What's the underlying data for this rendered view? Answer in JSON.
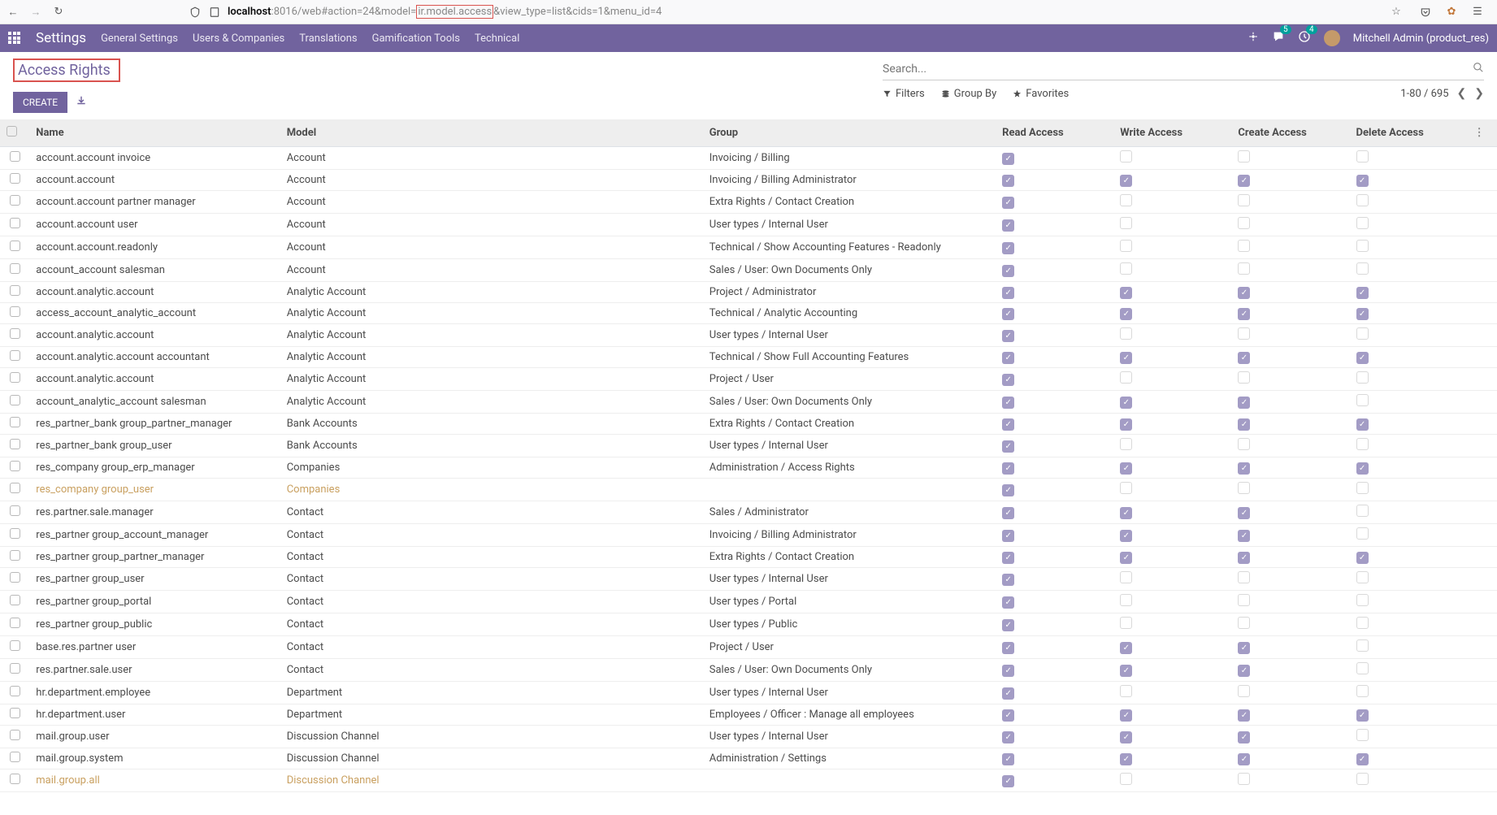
{
  "browser": {
    "url_pre": "localhost",
    "url_port": ":8016/web#action=24&model=",
    "url_highlight": "ir.model.access",
    "url_post": "&view_type=list&cids=1&menu_id=4"
  },
  "top_menu": {
    "title": "Settings",
    "items": [
      "General Settings",
      "Users & Companies",
      "Translations",
      "Gamification Tools",
      "Technical"
    ],
    "msg_badge": "5",
    "activity_badge": "4",
    "user": "Mitchell Admin (product_res)"
  },
  "control_panel": {
    "breadcrumb": "Access Rights",
    "create": "CREATE",
    "search_placeholder": "Search...",
    "filters": "Filters",
    "group_by": "Group By",
    "favorites": "Favorites",
    "pager": "1-80 / 695"
  },
  "table": {
    "headers": {
      "name": "Name",
      "model": "Model",
      "group": "Group",
      "read": "Read Access",
      "write": "Write Access",
      "create": "Create Access",
      "delete": "Delete Access"
    },
    "rows": [
      {
        "name": "account.account invoice",
        "model": "Account",
        "group": "Invoicing / Billing",
        "r": true,
        "w": false,
        "c": false,
        "d": false
      },
      {
        "name": "account.account",
        "model": "Account",
        "group": "Invoicing / Billing Administrator",
        "r": true,
        "w": true,
        "c": true,
        "d": true
      },
      {
        "name": "account.account partner manager",
        "model": "Account",
        "group": "Extra Rights / Contact Creation",
        "r": true,
        "w": false,
        "c": false,
        "d": false
      },
      {
        "name": "account.account user",
        "model": "Account",
        "group": "User types / Internal User",
        "r": true,
        "w": false,
        "c": false,
        "d": false
      },
      {
        "name": "account.account.readonly",
        "model": "Account",
        "group": "Technical / Show Accounting Features - Readonly",
        "r": true,
        "w": false,
        "c": false,
        "d": false
      },
      {
        "name": "account_account salesman",
        "model": "Account",
        "group": "Sales / User: Own Documents Only",
        "r": true,
        "w": false,
        "c": false,
        "d": false
      },
      {
        "name": "account.analytic.account",
        "model": "Analytic Account",
        "group": "Project / Administrator",
        "r": true,
        "w": true,
        "c": true,
        "d": true
      },
      {
        "name": "access_account_analytic_account",
        "model": "Analytic Account",
        "group": "Technical / Analytic Accounting",
        "r": true,
        "w": true,
        "c": true,
        "d": true
      },
      {
        "name": "account.analytic.account",
        "model": "Analytic Account",
        "group": "User types / Internal User",
        "r": true,
        "w": false,
        "c": false,
        "d": false
      },
      {
        "name": "account.analytic.account accountant",
        "model": "Analytic Account",
        "group": "Technical / Show Full Accounting Features",
        "r": true,
        "w": true,
        "c": true,
        "d": true
      },
      {
        "name": "account.analytic.account",
        "model": "Analytic Account",
        "group": "Project / User",
        "r": true,
        "w": false,
        "c": false,
        "d": false
      },
      {
        "name": "account_analytic_account salesman",
        "model": "Analytic Account",
        "group": "Sales / User: Own Documents Only",
        "r": true,
        "w": true,
        "c": true,
        "d": false
      },
      {
        "name": "res_partner_bank group_partner_manager",
        "model": "Bank Accounts",
        "group": "Extra Rights / Contact Creation",
        "r": true,
        "w": true,
        "c": true,
        "d": true
      },
      {
        "name": "res_partner_bank group_user",
        "model": "Bank Accounts",
        "group": "User types / Internal User",
        "r": true,
        "w": false,
        "c": false,
        "d": false
      },
      {
        "name": "res_company group_erp_manager",
        "model": "Companies",
        "group": "Administration / Access Rights",
        "r": true,
        "w": true,
        "c": true,
        "d": true
      },
      {
        "name": "res_company group_user",
        "model": "Companies",
        "group": "",
        "r": true,
        "w": false,
        "c": false,
        "d": false,
        "highlight": true
      },
      {
        "name": "res.partner.sale.manager",
        "model": "Contact",
        "group": "Sales / Administrator",
        "r": true,
        "w": true,
        "c": true,
        "d": false
      },
      {
        "name": "res_partner group_account_manager",
        "model": "Contact",
        "group": "Invoicing / Billing Administrator",
        "r": true,
        "w": true,
        "c": true,
        "d": false
      },
      {
        "name": "res_partner group_partner_manager",
        "model": "Contact",
        "group": "Extra Rights / Contact Creation",
        "r": true,
        "w": true,
        "c": true,
        "d": true
      },
      {
        "name": "res_partner group_user",
        "model": "Contact",
        "group": "User types / Internal User",
        "r": true,
        "w": false,
        "c": false,
        "d": false
      },
      {
        "name": "res_partner group_portal",
        "model": "Contact",
        "group": "User types / Portal",
        "r": true,
        "w": false,
        "c": false,
        "d": false
      },
      {
        "name": "res_partner group_public",
        "model": "Contact",
        "group": "User types / Public",
        "r": true,
        "w": false,
        "c": false,
        "d": false
      },
      {
        "name": "base.res.partner user",
        "model": "Contact",
        "group": "Project / User",
        "r": true,
        "w": true,
        "c": true,
        "d": false
      },
      {
        "name": "res.partner.sale.user",
        "model": "Contact",
        "group": "Sales / User: Own Documents Only",
        "r": true,
        "w": true,
        "c": true,
        "d": false
      },
      {
        "name": "hr.department.employee",
        "model": "Department",
        "group": "User types / Internal User",
        "r": true,
        "w": false,
        "c": false,
        "d": false
      },
      {
        "name": "hr.department.user",
        "model": "Department",
        "group": "Employees / Officer : Manage all employees",
        "r": true,
        "w": true,
        "c": true,
        "d": true
      },
      {
        "name": "mail.group.user",
        "model": "Discussion Channel",
        "group": "User types / Internal User",
        "r": true,
        "w": true,
        "c": true,
        "d": false
      },
      {
        "name": "mail.group.system",
        "model": "Discussion Channel",
        "group": "Administration / Settings",
        "r": true,
        "w": true,
        "c": true,
        "d": true
      },
      {
        "name": "mail.group.all",
        "model": "Discussion Channel",
        "group": "",
        "r": true,
        "w": false,
        "c": false,
        "d": false,
        "highlight": true
      }
    ]
  }
}
